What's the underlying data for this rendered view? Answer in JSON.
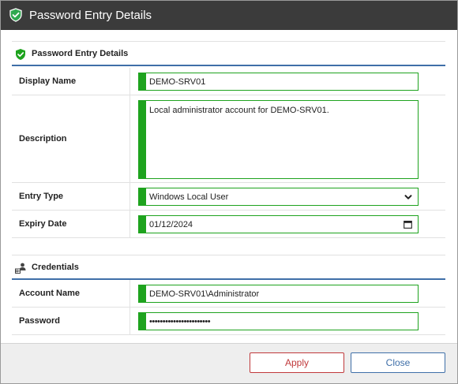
{
  "window": {
    "title": "Password Entry Details",
    "icon": "shield-check-icon"
  },
  "sections": {
    "details": {
      "label": "Password Entry Details",
      "icon": "shield-check-icon"
    },
    "credentials": {
      "label": "Credentials",
      "icon": "credentials-icon"
    }
  },
  "fields": {
    "display_name": {
      "label": "Display Name",
      "value": "DEMO-SRV01"
    },
    "description": {
      "label": "Description",
      "value": "Local administrator account for DEMO-SRV01."
    },
    "entry_type": {
      "label": "Entry Type",
      "value": "Windows Local User"
    },
    "expiry_date": {
      "label": "Expiry Date",
      "value": "01/12/2024"
    },
    "account_name": {
      "label": "Account Name",
      "value": "DEMO-SRV01\\Administrator"
    },
    "password": {
      "label": "Password",
      "value": "•••••••••••••••••••••••"
    }
  },
  "footer": {
    "apply_label": "Apply",
    "close_label": "Close"
  },
  "colors": {
    "valid": "#1ea31e",
    "accent": "#3f6fa8",
    "apply": "#c0393b",
    "titlebar": "#3b3b3b"
  }
}
